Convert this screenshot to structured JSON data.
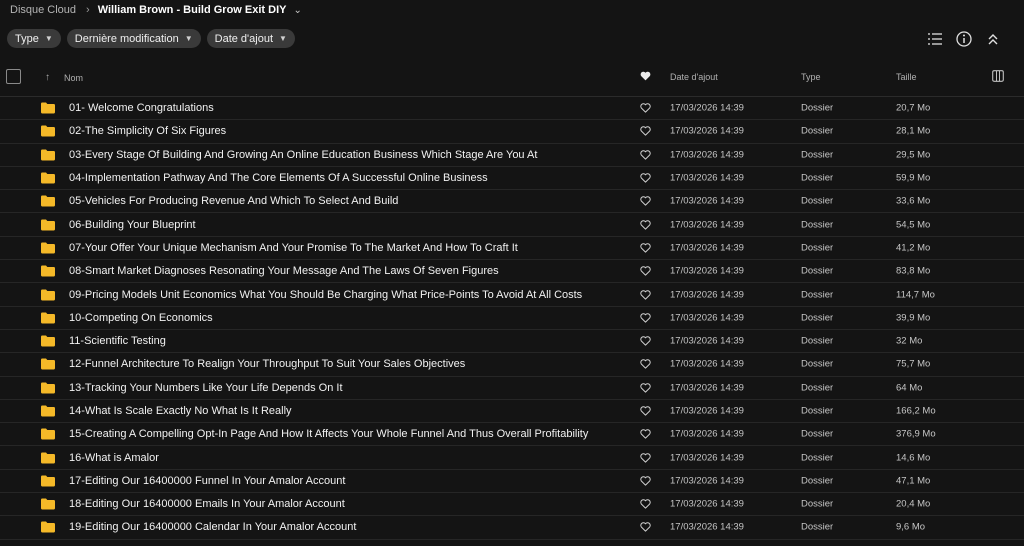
{
  "breadcrumb": {
    "root": "Disque Cloud",
    "current": "William Brown - Build Grow Exit DIY"
  },
  "filters": [
    {
      "label": "Type"
    },
    {
      "label": "Dernière modification"
    },
    {
      "label": "Date d'ajout"
    }
  ],
  "columns": {
    "name": "Nom",
    "date_added": "Date d'ajout",
    "type": "Type",
    "size": "Taille"
  },
  "colors": {
    "folder": "#f5b928",
    "background": "#141414"
  },
  "rows": [
    {
      "name": "01- Welcome Congratulations",
      "date": "17/03/2026 14:39",
      "type": "Dossier",
      "size": "20,7 Mo"
    },
    {
      "name": "02-The Simplicity Of Six Figures",
      "date": "17/03/2026 14:39",
      "type": "Dossier",
      "size": "28,1 Mo"
    },
    {
      "name": "03-Every Stage Of Building And Growing An Online Education Business Which Stage Are You At",
      "date": "17/03/2026 14:39",
      "type": "Dossier",
      "size": "29,5 Mo"
    },
    {
      "name": "04-Implementation Pathway And The Core Elements Of A Successful Online Business",
      "date": "17/03/2026 14:39",
      "type": "Dossier",
      "size": "59,9 Mo"
    },
    {
      "name": "05-Vehicles For Producing Revenue And Which To Select And Build",
      "date": "17/03/2026 14:39",
      "type": "Dossier",
      "size": "33,6 Mo"
    },
    {
      "name": "06-Building Your Blueprint",
      "date": "17/03/2026 14:39",
      "type": "Dossier",
      "size": "54,5 Mo"
    },
    {
      "name": "07-Your Offer Your Unique Mechanism And Your Promise To The Market And How To Craft It",
      "date": "17/03/2026 14:39",
      "type": "Dossier",
      "size": "41,2 Mo"
    },
    {
      "name": "08-Smart Market Diagnoses Resonating Your Message And The Laws Of Seven Figures",
      "date": "17/03/2026 14:39",
      "type": "Dossier",
      "size": "83,8 Mo"
    },
    {
      "name": "09-Pricing Models Unit Economics What You Should Be Charging What Price-Points To Avoid At All Costs",
      "date": "17/03/2026 14:39",
      "type": "Dossier",
      "size": "114,7 Mo"
    },
    {
      "name": "10-Competing On Economics",
      "date": "17/03/2026 14:39",
      "type": "Dossier",
      "size": "39,9 Mo"
    },
    {
      "name": "11-Scientific Testing",
      "date": "17/03/2026 14:39",
      "type": "Dossier",
      "size": "32 Mo"
    },
    {
      "name": "12-Funnel Architecture To Realign Your Throughput To Suit Your Sales Objectives",
      "date": "17/03/2026 14:39",
      "type": "Dossier",
      "size": "75,7 Mo"
    },
    {
      "name": "13-Tracking Your Numbers Like Your Life Depends On It",
      "date": "17/03/2026 14:39",
      "type": "Dossier",
      "size": "64 Mo"
    },
    {
      "name": "14-What Is Scale Exactly No What Is It Really",
      "date": "17/03/2026 14:39",
      "type": "Dossier",
      "size": "166,2 Mo"
    },
    {
      "name": "15-Creating A Compelling Opt-In Page And How It Affects Your Whole Funnel And Thus Overall Profitability",
      "date": "17/03/2026 14:39",
      "type": "Dossier",
      "size": "376,9 Mo"
    },
    {
      "name": "16-What is Amalor",
      "date": "17/03/2026 14:39",
      "type": "Dossier",
      "size": "14,6 Mo"
    },
    {
      "name": "17-Editing Our 16400000 Funnel In Your Amalor Account",
      "date": "17/03/2026 14:39",
      "type": "Dossier",
      "size": "47,1 Mo"
    },
    {
      "name": "18-Editing Our 16400000 Emails In Your Amalor Account",
      "date": "17/03/2026 14:39",
      "type": "Dossier",
      "size": "20,4 Mo"
    },
    {
      "name": "19-Editing Our 16400000 Calendar In Your Amalor Account",
      "date": "17/03/2026 14:39",
      "type": "Dossier",
      "size": "9,6 Mo"
    }
  ]
}
